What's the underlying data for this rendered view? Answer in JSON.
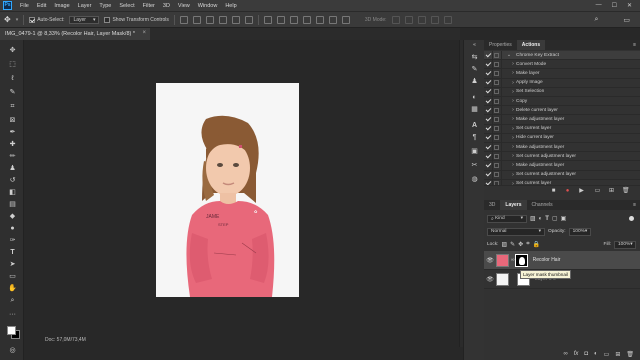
{
  "app": {
    "logo": "Ps"
  },
  "menu": [
    "File",
    "Edit",
    "Image",
    "Layer",
    "Type",
    "Select",
    "Filter",
    "3D",
    "View",
    "Window",
    "Help"
  ],
  "window_controls": [
    "—",
    "☐",
    "✕"
  ],
  "options": {
    "auto_select_label": "Auto-Select:",
    "auto_select_value": "Layer",
    "transform_label": "Show Transform Controls",
    "mode_3d": "3D Mode:"
  },
  "document": {
    "tab_title": "IMG_0479-1 @ 8,33% (Recolor Hair, Layer Mask/8) *",
    "close": "×"
  },
  "status": {
    "doc_info": "Doc: 57,0M/73,4M"
  },
  "panels": {
    "top_tabs": [
      "Properties",
      "Actions"
    ],
    "actions": [
      {
        "label": "Chrome Key Extract",
        "checked": true,
        "expanded": true
      },
      {
        "label": "Convert Mode",
        "checked": true
      },
      {
        "label": "Make layer",
        "checked": true
      },
      {
        "label": "Apply Image",
        "checked": true
      },
      {
        "label": "Set Selection",
        "checked": true
      },
      {
        "label": "Copy",
        "checked": true
      },
      {
        "label": "Delete current layer",
        "checked": true
      },
      {
        "label": "Make adjustment layer",
        "checked": true
      },
      {
        "label": "Set current layer",
        "checked": true
      },
      {
        "label": "Hide current layer",
        "checked": true
      },
      {
        "label": "Make adjustment layer",
        "checked": true
      },
      {
        "label": "Set current adjustment layer",
        "checked": true
      },
      {
        "label": "Make adjustment layer",
        "checked": true
      },
      {
        "label": "Set current adjustment layer",
        "checked": true
      },
      {
        "label": "Set current layer",
        "checked": true
      }
    ],
    "layer_tabs": [
      "3D",
      "Layers",
      "Channels"
    ],
    "kind_label": "Kind",
    "blend_mode": "Normal",
    "opacity_label": "Opacity:",
    "opacity_value": "100%",
    "lock_label": "Lock:",
    "fill_label": "Fill:",
    "fill_value": "100%",
    "layers": [
      {
        "name": "Recolor Hair",
        "selected": true
      },
      {
        "name": "Layer 0 c",
        "selected": false
      }
    ],
    "tooltip": "Layer mask thumbnail"
  },
  "colors": {
    "accent_blue": "#31a8ff",
    "shirt_pink": "#e8687a",
    "hair_brown": "#8a5a34"
  }
}
